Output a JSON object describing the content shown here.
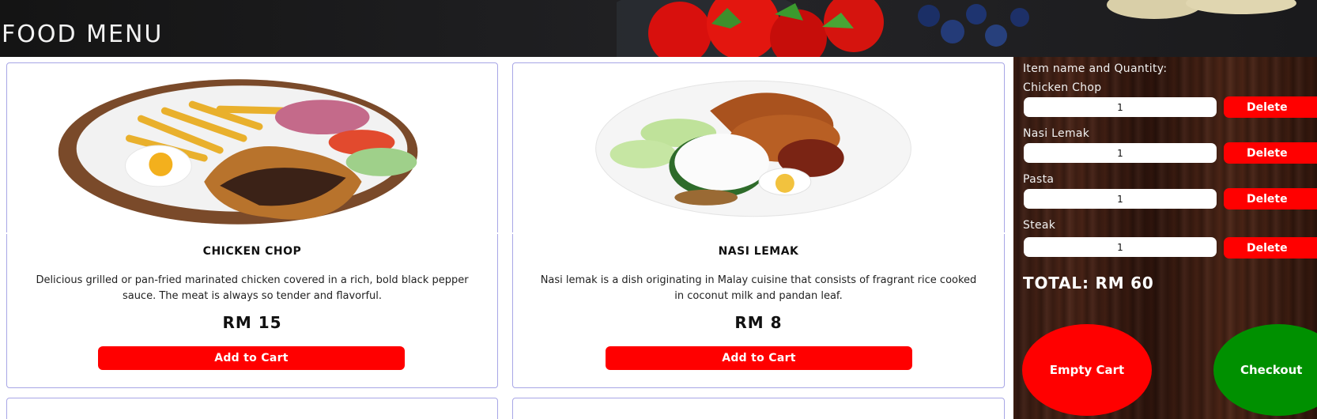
{
  "header": {
    "title": "FOOD MENU"
  },
  "menu": {
    "items": [
      {
        "name": "CHICKEN CHOP",
        "description": "Delicious grilled or pan-fried marinated chicken covered in a rich, bold black pepper sauce. The meat is always so tender and flavorful.",
        "price": "RM 15",
        "button_label": "Add to Cart"
      },
      {
        "name": "NASI LEMAK",
        "description": "Nasi lemak is a dish originating in Malay cuisine that consists of fragrant rice cooked in coconut milk and pandan leaf.",
        "price": "RM 8",
        "button_label": "Add to Cart"
      }
    ]
  },
  "cart": {
    "heading": "Item name and Quantity:",
    "items": [
      {
        "name": "Chicken Chop",
        "quantity": "1",
        "delete_label": "Delete"
      },
      {
        "name": "Nasi Lemak",
        "quantity": "1",
        "delete_label": "Delete"
      },
      {
        "name": "Pasta",
        "quantity": "1",
        "delete_label": "Delete"
      },
      {
        "name": "Steak",
        "quantity": "1",
        "delete_label": "Delete"
      }
    ],
    "total": "TOTAL: RM 60",
    "empty_label": "Empty Cart",
    "checkout_label": "Checkout"
  },
  "colors": {
    "accent_red": "#ff0000",
    "checkout_green": "#009000",
    "card_border": "#a8a6e6"
  }
}
